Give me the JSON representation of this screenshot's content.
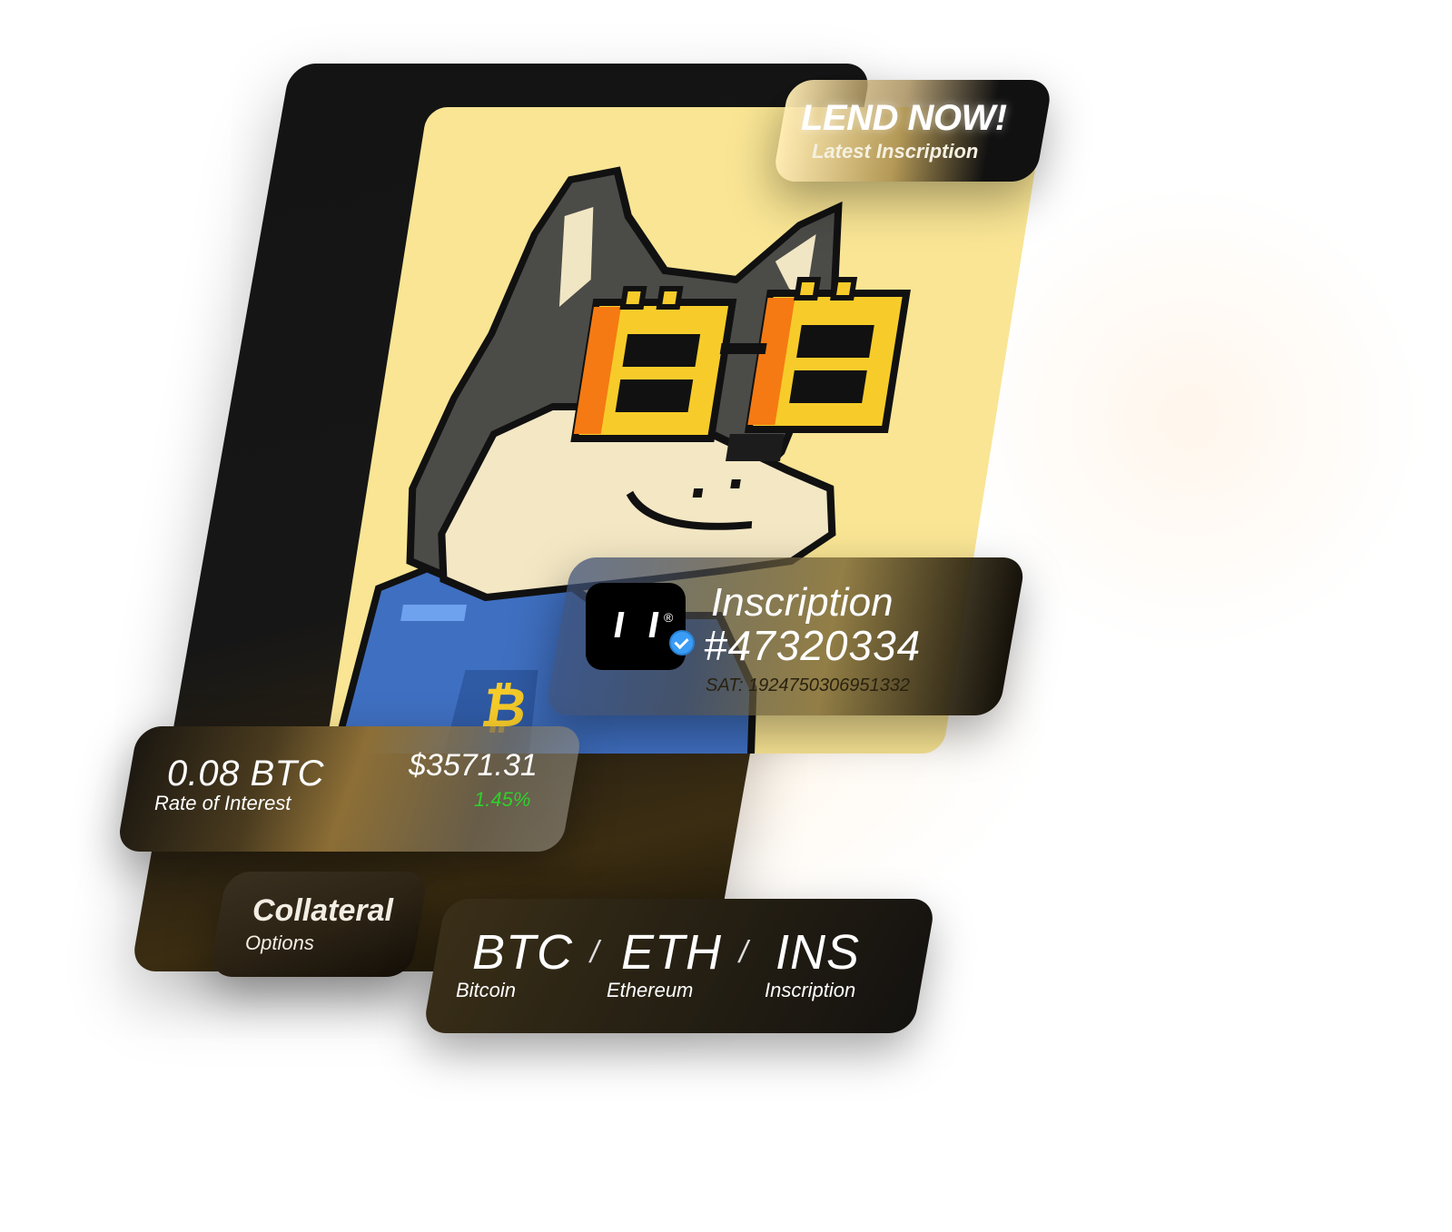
{
  "lend": {
    "title": "LEND NOW!",
    "subtitle": "Latest Inscription"
  },
  "inscription": {
    "title": "Inscription",
    "number": "#47320334",
    "sat": "SAT: 1924750306951332",
    "logo_mark": "®",
    "verified_icon": "verified-badge-icon"
  },
  "rate": {
    "btc": "0.08 BTC",
    "label": "Rate of Interest",
    "usd": "$3571.31",
    "percent": "1.45%",
    "percent_color": "#2fd12a"
  },
  "collateral": {
    "title": "Collateral",
    "subtitle": "Options"
  },
  "coins": [
    {
      "symbol": "BTC",
      "name": "Bitcoin"
    },
    {
      "symbol": "ETH",
      "name": "Ethereum"
    },
    {
      "symbol": "INS",
      "name": "Inscription"
    }
  ],
  "separator": "/",
  "colors": {
    "art_background": "#f9e594",
    "card_dark": "#141414",
    "accent_gold": "#8d6f36"
  },
  "art": {
    "icon": "pixel-doge-bitcoin-glasses-image"
  }
}
